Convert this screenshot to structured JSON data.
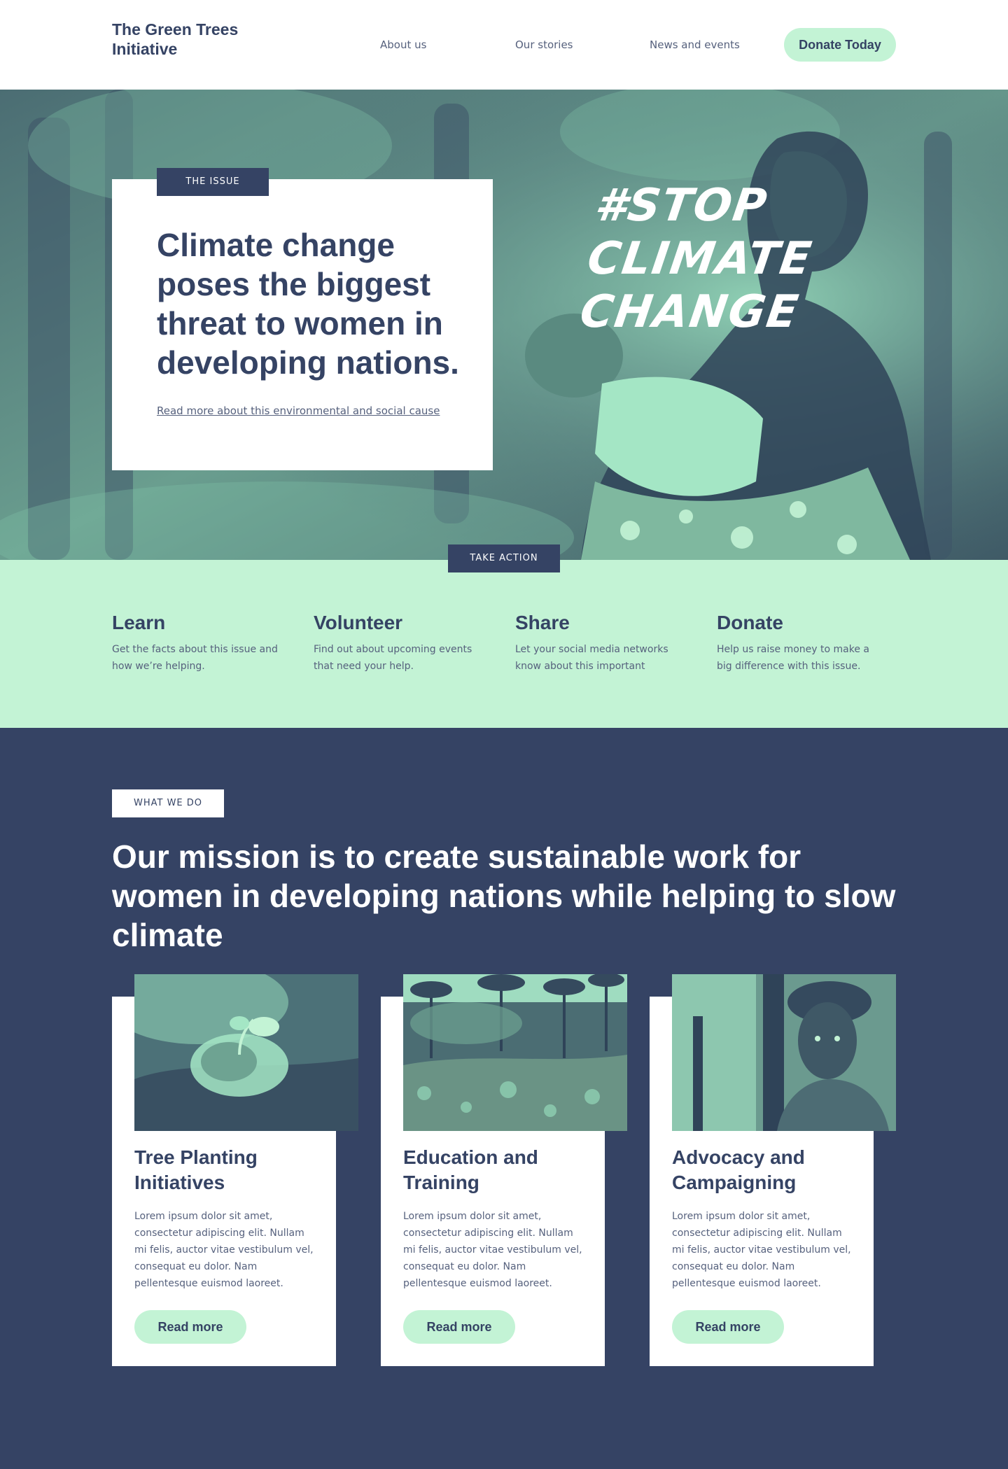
{
  "header": {
    "logo": "The Green Trees Initiative",
    "nav": [
      "About us",
      "Our stories",
      "News and events"
    ],
    "donate_label": "Donate Today"
  },
  "hero": {
    "tag": "THE ISSUE",
    "heading": "Climate change poses the biggest threat to women in developing nations.",
    "link": "Read more about this environmental and social cause",
    "hashtag": [
      "#STOP",
      "CLIMATE",
      "CHANGE"
    ]
  },
  "take_action": {
    "tag": "TAKE ACTION",
    "items": [
      {
        "title": "Learn",
        "desc": "Get the facts about this issue and how we’re helping."
      },
      {
        "title": "Volunteer",
        "desc": "Find out about upcoming events that need your help."
      },
      {
        "title": "Share",
        "desc": "Let your social media networks know about this important"
      },
      {
        "title": "Donate",
        "desc": "Help us raise money to make a big difference with this issue."
      }
    ]
  },
  "mission": {
    "tag": "WHAT WE DO",
    "heading": "Our mission is to create sustainable work for women in developing nations while helping to slow climate",
    "cards": [
      {
        "title": "Tree Planting Initiatives",
        "text": "Lorem ipsum dolor sit amet, consectetur adipiscing elit. Nullam mi felis, auctor vitae vestibulum vel, consequat eu dolor. Nam pellentesque euismod laoreet.",
        "button": "Read more",
        "image": "seedling-in-hands-photo"
      },
      {
        "title": "Education and Training",
        "text": "Lorem ipsum dolor sit amet, consectetur adipiscing elit. Nullam mi felis, auctor vitae vestibulum vel, consequat eu dolor. Nam pellentesque euismod laoreet.",
        "button": "Read more",
        "image": "palm-forest-field-photo"
      },
      {
        "title": "Advocacy and Campaigning",
        "text": "Lorem ipsum dolor sit amet, consectetur adipiscing elit. Nullam mi felis, auctor vitae vestibulum vel, consequat eu dolor. Nam pellentesque euismod laoreet.",
        "button": "Read more",
        "image": "woman-portrait-photo"
      }
    ]
  },
  "colors": {
    "navy": "#354364",
    "mint": "#c3f3d5",
    "white": "#ffffff",
    "text_muted": "#56617d"
  }
}
